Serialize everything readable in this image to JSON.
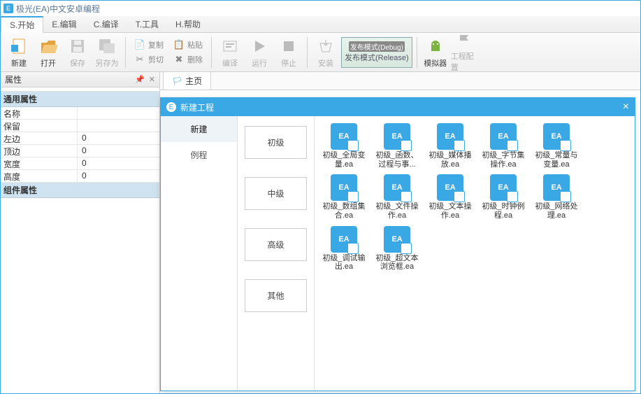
{
  "app": {
    "title": "极光(EA)中文安卓编程"
  },
  "menu": {
    "items": [
      {
        "label": "S.开始"
      },
      {
        "label": "E.编辑"
      },
      {
        "label": "C.编译"
      },
      {
        "label": "T.工具"
      },
      {
        "label": "H.帮助"
      }
    ]
  },
  "toolbar": {
    "new": "新建",
    "open": "打开",
    "save": "保存",
    "saveas": "另存为",
    "copy": "复制",
    "cut": "剪切",
    "paste": "粘贴",
    "delete": "删除",
    "compile": "编译",
    "run": "运行",
    "stop": "停止",
    "install": "安装",
    "release_top": "发布模式(Debug)",
    "release": "发布模式(Release)",
    "emulator": "模拟器",
    "projcfg": "工程配置"
  },
  "leftPanel": {
    "title": "属性",
    "cat1": "通用属性",
    "rows1": [
      {
        "name": "名称",
        "val": ""
      },
      {
        "name": "保留",
        "val": ""
      },
      {
        "name": "左边",
        "val": "0"
      },
      {
        "name": "顶边",
        "val": "0"
      },
      {
        "name": "宽度",
        "val": "0"
      },
      {
        "name": "高度",
        "val": "0"
      }
    ],
    "cat2": "组件属性"
  },
  "tabs": {
    "main": "主页"
  },
  "dialog": {
    "title": "新建工程",
    "leftTabs": [
      {
        "label": "新建"
      },
      {
        "label": "例程"
      }
    ],
    "levels": [
      {
        "label": "初级"
      },
      {
        "label": "中级"
      },
      {
        "label": "高级"
      },
      {
        "label": "其他"
      }
    ],
    "projects": [
      {
        "label": "初级_全局变量.ea"
      },
      {
        "label": "初级_函数、过程与事..."
      },
      {
        "label": "初级_媒体播放.ea"
      },
      {
        "label": "初级_字节集操作.ea"
      },
      {
        "label": "初级_常量与变量.ea"
      },
      {
        "label": "初级_数组集合.ea"
      },
      {
        "label": "初级_文件操作.ea"
      },
      {
        "label": "初级_文本操作.ea"
      },
      {
        "label": "初级_时钟例程.ea"
      },
      {
        "label": "初级_网络处理.ea"
      },
      {
        "label": "初级_调试输出.ea"
      },
      {
        "label": "初级_超文本浏览框.ea"
      }
    ]
  }
}
